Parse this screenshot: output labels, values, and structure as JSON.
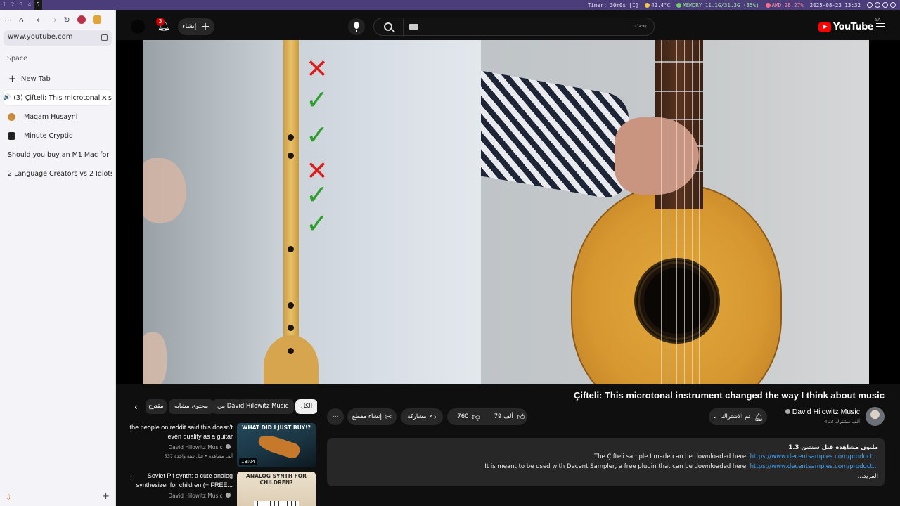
{
  "system_bar": {
    "workspaces": [
      "1",
      "2",
      "3",
      "4",
      "5"
    ],
    "timer": "Timer: 30m0s [I]",
    "temp": "42.4°C",
    "memory": "MEMORY 11.1G/31.3G (35%)",
    "amd": "AMD 28.27%",
    "datetime": "2025-08-23 13:32"
  },
  "browser_sidebar": {
    "url": "www.youtube.com",
    "space_label": "Space",
    "new_tab_label": "New Tab",
    "tabs": [
      {
        "label": "(3) Çifteli: This microtonal instrument",
        "icon": "youtube-icon",
        "active": true
      },
      {
        "label": "Maqam Husayni",
        "icon": "maqam-icon"
      },
      {
        "label": "Minute Cryptic",
        "icon": "minute-cryptic-icon"
      },
      {
        "label": "Should you buy an M1 Mac for",
        "icon": "youtube-icon"
      },
      {
        "label": "2 Language Creators vs 2 Idiots",
        "icon": "youtube-icon"
      }
    ]
  },
  "masthead": {
    "notification_count": "3",
    "create_label": "إنشاء",
    "search_placeholder": "بحث",
    "logo_text": "YouTube",
    "region": "SA"
  },
  "video": {
    "title": "Çifteli: This microtonal instrument changed the way I think about music",
    "marks": [
      "✕",
      "✓",
      "✓",
      "✕",
      "✓",
      "✓"
    ]
  },
  "chips": [
    {
      "label": "الكل",
      "active": true
    },
    {
      "label": "من David Hilowitz Music"
    },
    {
      "label": "محتوى مشابه"
    },
    {
      "label": "مقترح"
    }
  ],
  "actions": {
    "likes": "79 ألف",
    "dislikes": "760",
    "share": "مشاركة",
    "clip": "إنشاء مقطع",
    "more": "⋯"
  },
  "channel": {
    "name": "David Hilowitz Music",
    "subscribers": "403 ألف مشترك",
    "subscribe_label": "تم الاشتراك"
  },
  "recommended": [
    {
      "title": "the people on reddit said this doesn't even qualify as a guitar",
      "channel": "David Hilowitz Music",
      "meta": "537 ألف مشاهدة • قبل سنة واحدة",
      "duration": "13:04",
      "thumb_caption": "WHAT DID I JUST BUY!?"
    },
    {
      "title": "Soviet Pif synth: a cute analog synthesizer for children (+ FREE...",
      "channel": "David Hilowitz Music",
      "meta": "",
      "duration": "",
      "thumb_caption": "ANALOG SYNTH FOR CHILDREN?"
    }
  ],
  "description": {
    "stats": "1.3 مليون مشاهدة قبل سنتين",
    "line1_text": "The Çifteli sample I made can be downloaded here: ",
    "line1_link": "https://www.decentsamples.com/product...",
    "line2_text": "It is meant to be used with Decent Sampler, a free plugin that can be downloaded here: ",
    "line2_link": "https://www.decentsamples.com/product...",
    "more": "...المزيد"
  }
}
